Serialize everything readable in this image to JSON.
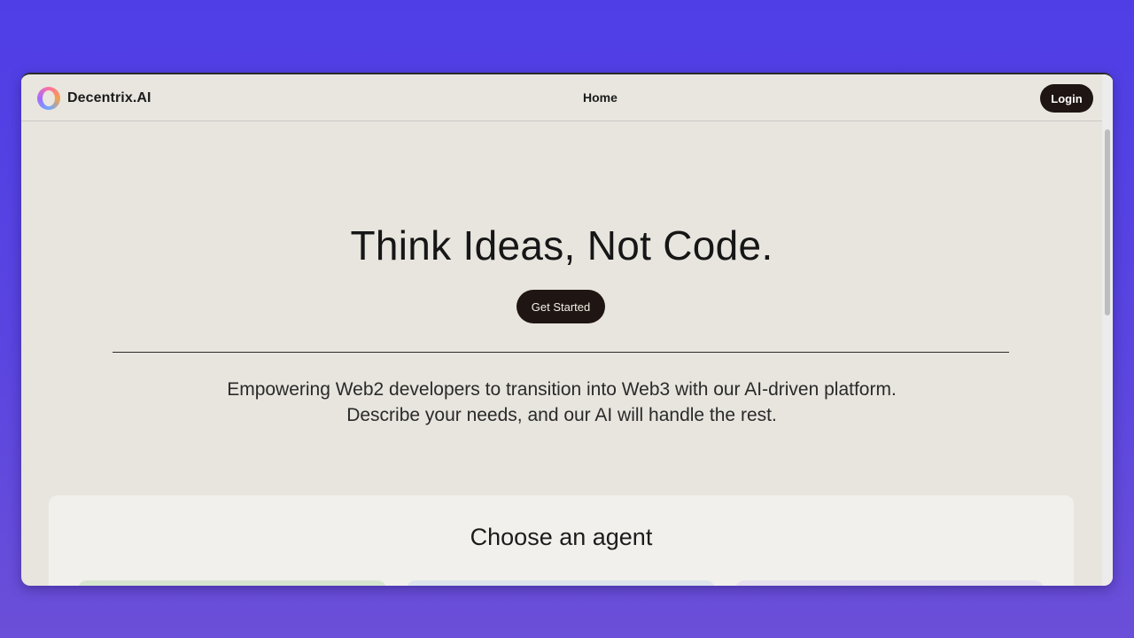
{
  "brand": {
    "name": "Decentrix.AI",
    "logo_icon": "ring-logo-icon"
  },
  "nav": {
    "home_label": "Home",
    "login_label": "Login"
  },
  "hero": {
    "title": "Think Ideas, Not Code.",
    "cta_label": "Get Started",
    "subtitle_line1": "Empowering Web2 developers to transition into Web3 with our AI-driven platform.",
    "subtitle_line2": "Describe your needs, and our AI will handle the rest."
  },
  "agents": {
    "title": "Choose an agent"
  },
  "colors": {
    "background_gradient": [
      "#4f3ee6",
      "#6b4fd8"
    ],
    "page": "#e8e5de",
    "button": "#1f1512",
    "tile_green": "#d7e6cf",
    "tile_blue": "#dde4ec",
    "tile_purple": "#e6dfee"
  }
}
